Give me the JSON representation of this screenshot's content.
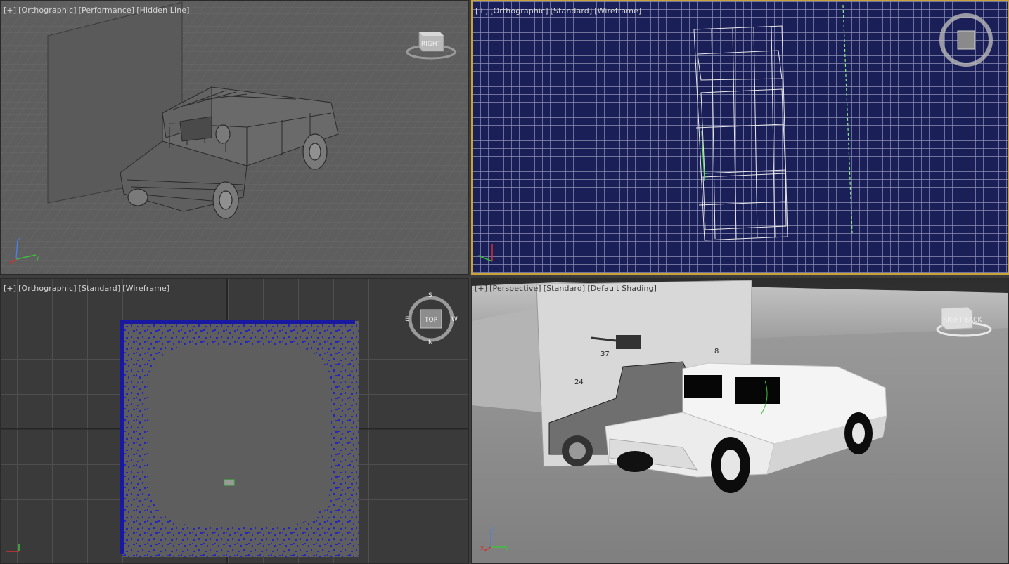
{
  "viewports": {
    "top_left": {
      "labels": [
        "[+]",
        "[Orthographic]",
        "[Performance]",
        "[Hidden Line]"
      ]
    },
    "top_right": {
      "labels": [
        "[+]",
        "[Orthographic]",
        "[Standard]",
        "[Wireframe]"
      ]
    },
    "bottom_left": {
      "labels": [
        "[+]",
        "[Orthographic]",
        "[Standard]",
        "[Wireframe]"
      ]
    },
    "bottom_right": {
      "labels": [
        "[+]",
        "[Perspective]",
        "[Standard]",
        "[Default Shading]"
      ]
    }
  },
  "viewcube": {
    "top_left_face": "RIGHT",
    "bottom_left_face": "TOP",
    "bottom_left_compass": [
      "S",
      "E",
      "W",
      "N"
    ],
    "bottom_right_faces": [
      "RIGHT",
      "BACK"
    ]
  },
  "axes": {
    "x": "x",
    "y": "y",
    "z": "z"
  },
  "callouts": [
    "37",
    "24",
    "8"
  ],
  "colors": {
    "active_border": "#c9a23a",
    "wireframe_bg": "#1b1f57",
    "axis_x": "#d33030",
    "axis_y": "#3fbf3f",
    "axis_z": "#4a7ee0"
  }
}
